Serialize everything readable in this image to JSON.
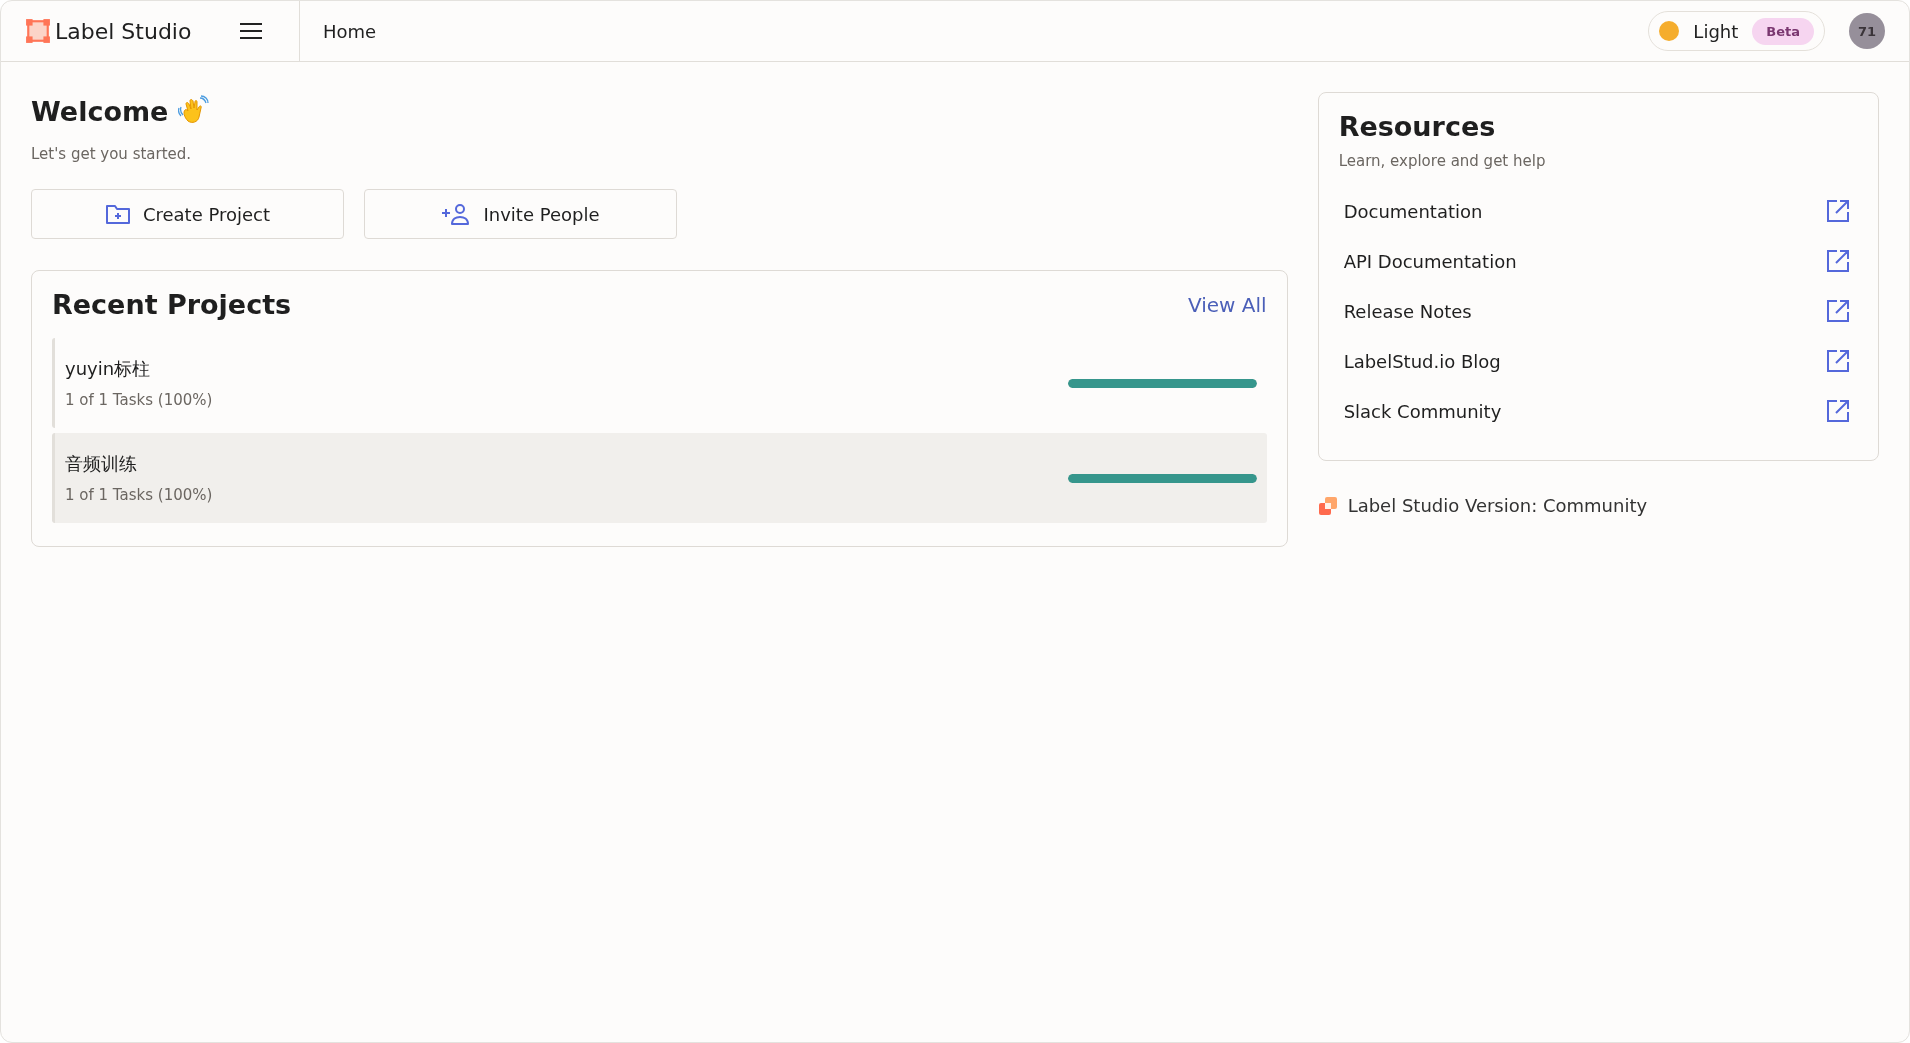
{
  "header": {
    "app_name": "Label Studio",
    "breadcrumb": "Home",
    "theme_toggle": {
      "label": "Light",
      "badge": "Beta"
    },
    "avatar": "71"
  },
  "welcome": {
    "title": "Welcome",
    "subtitle": "Let's get you started.",
    "actions": [
      {
        "label": "Create Project",
        "kind": "folder"
      },
      {
        "label": "Invite People",
        "kind": "person"
      }
    ]
  },
  "recent_projects": {
    "title": "Recent Projects",
    "view_all": "View All",
    "items": [
      {
        "name": "yuyin标柱",
        "tasks": "1 of 1 Tasks (100%)",
        "level": 1,
        "hovered": false
      },
      {
        "name": "音频训练",
        "tasks": "1 of 1 Tasks (100%)",
        "level": 1,
        "hovered": true
      }
    ]
  },
  "resources": {
    "title": "Resources",
    "subtitle": "Learn, explore and get help",
    "links": [
      "Documentation",
      "API Documentation",
      "Release Notes",
      "LabelStud.io Blog",
      "Slack Community"
    ]
  },
  "version": "Label Studio Version: Community"
}
